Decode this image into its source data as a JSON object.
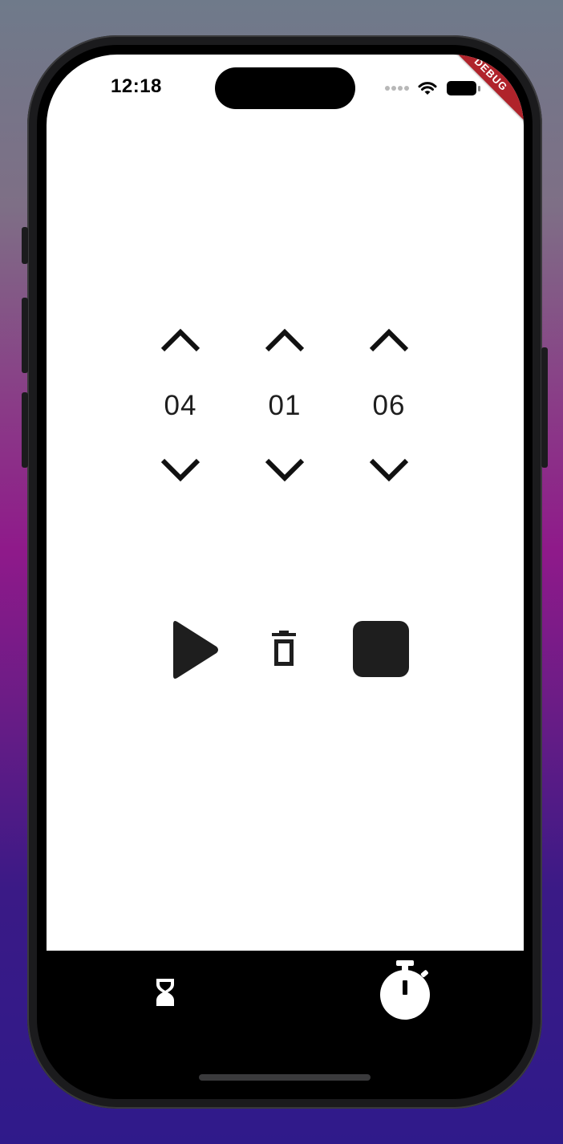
{
  "status_bar": {
    "time": "12:18",
    "debug_label": "DEBUG"
  },
  "timer": {
    "hours": "04",
    "minutes": "01",
    "seconds": "06"
  },
  "controls": {
    "play_icon": "play-icon",
    "delete_icon": "trash-icon",
    "stop_icon": "stop-icon"
  },
  "tabs": [
    {
      "icon": "hourglass-icon"
    },
    {
      "icon": "stopwatch-icon"
    }
  ],
  "colors": {
    "icon": "#111111",
    "debug_banner": "#b0232b",
    "tab_bar": "#000000"
  }
}
